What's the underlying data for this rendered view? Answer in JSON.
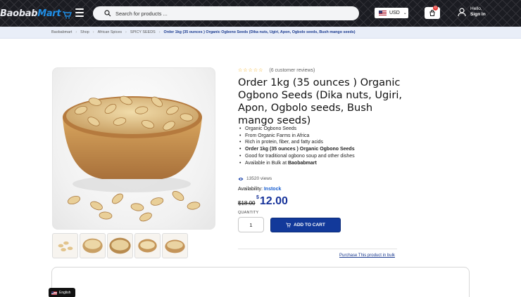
{
  "header": {
    "logo_text_main": "Baobab",
    "logo_text_accent": "Mart",
    "search_placeholder": "Search for products ...",
    "currency": "USD",
    "cart_count": "0",
    "user_line1": "Hello,",
    "user_line2": "Sign In"
  },
  "breadcrumb": {
    "items": [
      "Baobabmart",
      "Shop",
      "African Spices",
      "SPICY SEEDS"
    ],
    "current": "Order 1kg (35 ounces ) Organic Ogbono Seeds (Dika nuts, Ugiri, Apon, Ogbolo seeds, Bush mango seeds)"
  },
  "product": {
    "stars": "☆☆☆☆☆",
    "reviews": "(6 customer reviews)",
    "title": "Order 1kg (35 ounces ) Organic Ogbono Seeds (Dika nuts, Ugiri, Apon, Ogbolo seeds, Bush mango seeds)",
    "bullets": [
      "Organic Ogbono Seeds",
      "From Organic Farms in Africa",
      "Rich in protein, fiber, and fatty acids",
      "Order 1kg (35 ounces ) Organic Ogbono Seeds",
      "Good for traditional ogbono soup and other dishes",
      "Available in Bulk at "
    ],
    "bulk_brand": "Baobabmart",
    "views": "13520 views",
    "availability_label": "Availability:",
    "availability_value": "Instock",
    "old_price": "$18.00",
    "price_currency": "$",
    "price_value": "12.00",
    "quantity_label": "QUANTITY",
    "quantity_value": "1",
    "add_to_cart": "ADD TO CART",
    "bulk_link": "Purchase This product in bulk"
  },
  "language": {
    "label": "English"
  },
  "colors": {
    "header_bg": "#1b1c22",
    "accent_blue": "#12399a",
    "price_blue": "#17339a",
    "logo_accent": "#1f8ee6"
  },
  "icons": [
    "menu-icon",
    "search-icon",
    "flag-icon",
    "chevron-down-icon",
    "cart-icon",
    "user-icon",
    "eye-icon",
    "star-icon"
  ]
}
